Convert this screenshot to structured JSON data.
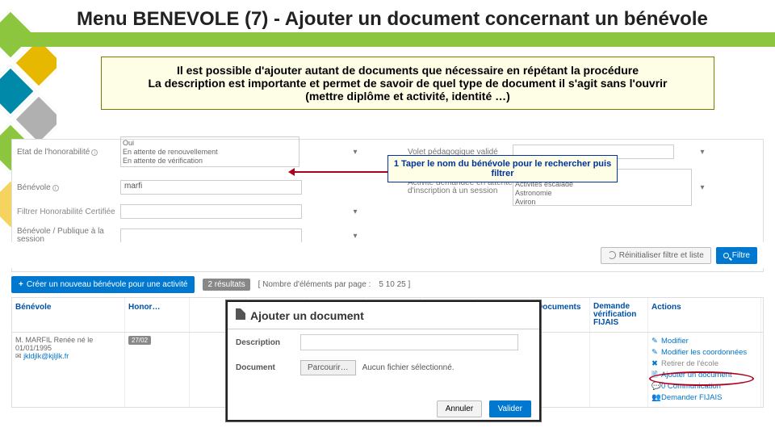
{
  "title": "Menu BENEVOLE (7) - Ajouter un document concernant un bénévole",
  "notice": {
    "line1": "Il est possible d'ajouter autant de documents que nécessaire en répétant la procédure",
    "line2": "La description est importante et permet de savoir de quel type de document il s'agit sans l'ouvrir",
    "line3": "(mettre diplôme et activité, identité …)"
  },
  "hint1": "1 Taper le nom du bénévole pour le rechercher puis filtrer",
  "filters": {
    "etat_lab": "Etat de l'honorabilité",
    "etat_opts": "Oui\nEn attente de renouvellement\nEn attente de vérification",
    "benevole_lab": "Bénévole",
    "benevole_val": "marfi",
    "filtre_link_lab": "Filtrer Honorabilité Certifiée",
    "benevole_pub_lab": "Bénévole / Publique à la session",
    "volet_lab": "Volet pédagogique validé",
    "activite_lab": "Activité demandée en attente d'inscription à un session",
    "activite_opts": "Activité aquatique\nActivités escalade\nAstronomie\nAviron"
  },
  "buttons": {
    "reset": "Réinitialiser filtre et liste",
    "filter": "Filtre",
    "create": "Créer un nouveau bénévole pour une activité",
    "results": "2 résultats",
    "pager_label": "[ Nombre d'éléments par page :",
    "pager_opts": "5 10 25 ]"
  },
  "table": {
    "headers": [
      "Bénévole",
      "Honor…",
      "",
      "",
      "",
      "",
      "",
      "",
      "Documents",
      "Demande vérification FIJAIS",
      "Actions"
    ],
    "row": {
      "name": "M. MARFIL Renée né le 01/01/1995",
      "mail": "jkldjlk@kjljlk.fr",
      "date": "27/02",
      "actions": {
        "modifier": "Modifier",
        "coords": "Modifier les coordonnées",
        "retirer": "Retirer de l'école",
        "ajdoc": "Ajouter un document",
        "comm": "0 Communication",
        "fijais": "Demander FIJAIS"
      }
    }
  },
  "modal": {
    "title": "Ajouter un document",
    "desc_lab": "Description",
    "doc_lab": "Document",
    "browse": "Parcourir…",
    "nofile": "Aucun fichier sélectionné.",
    "cancel": "Annuler",
    "ok": "Valider"
  }
}
